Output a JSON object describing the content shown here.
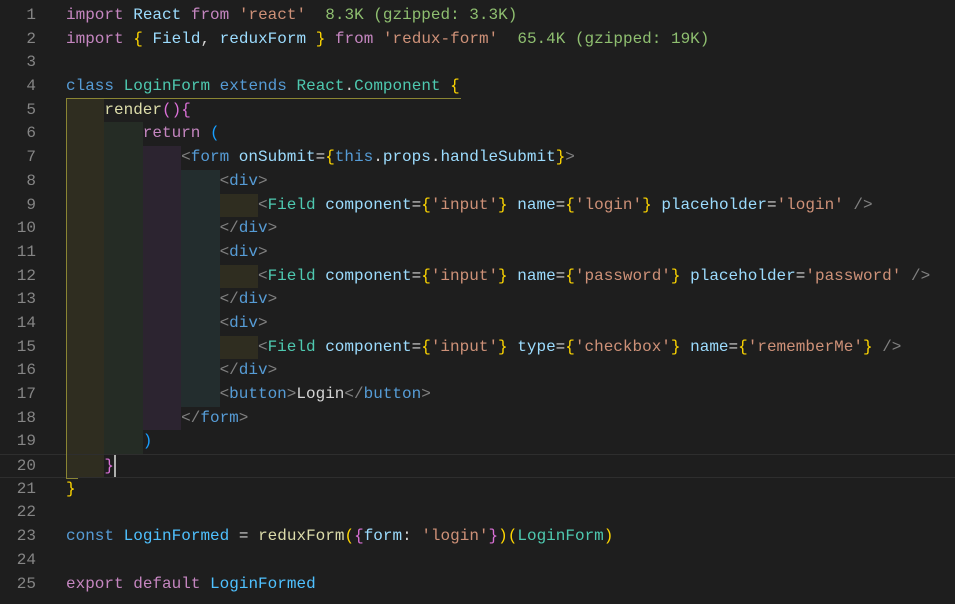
{
  "editor": {
    "lines": [
      {
        "n": "1",
        "indent": 0,
        "tokens": [
          [
            "k",
            "import"
          ],
          [
            "p",
            " "
          ],
          [
            "v",
            "React"
          ],
          [
            "p",
            " "
          ],
          [
            "k",
            "from"
          ],
          [
            "p",
            " "
          ],
          [
            "s",
            "'react'"
          ],
          [
            "p",
            "  "
          ],
          [
            "g",
            "8.3K (gzipped: 3.3K)"
          ]
        ]
      },
      {
        "n": "2",
        "indent": 0,
        "tokens": [
          [
            "k",
            "import"
          ],
          [
            "p",
            " "
          ],
          [
            "b1",
            "{"
          ],
          [
            "p",
            " "
          ],
          [
            "v",
            "Field"
          ],
          [
            "p",
            ", "
          ],
          [
            "v",
            "reduxForm"
          ],
          [
            "p",
            " "
          ],
          [
            "b1",
            "}"
          ],
          [
            "p",
            " "
          ],
          [
            "k",
            "from"
          ],
          [
            "p",
            " "
          ],
          [
            "s",
            "'redux-form'"
          ],
          [
            "p",
            "  "
          ],
          [
            "g",
            "65.4K (gzipped: 19K)"
          ]
        ]
      },
      {
        "n": "3",
        "indent": 0,
        "tokens": []
      },
      {
        "n": "4",
        "indent": 0,
        "tokens": [
          [
            "t",
            "class"
          ],
          [
            "p",
            " "
          ],
          [
            "c",
            "LoginForm"
          ],
          [
            "p",
            " "
          ],
          [
            "t",
            "extends"
          ],
          [
            "p",
            " "
          ],
          [
            "c",
            "React"
          ],
          [
            "p",
            "."
          ],
          [
            "c",
            "Component"
          ],
          [
            "p",
            " "
          ],
          [
            "b1",
            "{"
          ]
        ]
      },
      {
        "n": "5",
        "indent": 1,
        "tokens": [
          [
            "f",
            "render"
          ],
          [
            "b2",
            "()"
          ],
          [
            "b2",
            "{"
          ]
        ]
      },
      {
        "n": "6",
        "indent": 2,
        "tokens": [
          [
            "k",
            "return"
          ],
          [
            "p",
            " "
          ],
          [
            "b3",
            "("
          ]
        ]
      },
      {
        "n": "7",
        "indent": 3,
        "tokens": [
          [
            "tp",
            "<"
          ],
          [
            "t",
            "form"
          ],
          [
            "p",
            " "
          ],
          [
            "v",
            "onSubmit"
          ],
          [
            "p",
            "="
          ],
          [
            "b1",
            "{"
          ],
          [
            "t",
            "this"
          ],
          [
            "p",
            "."
          ],
          [
            "v",
            "props"
          ],
          [
            "p",
            "."
          ],
          [
            "v",
            "handleSubmit"
          ],
          [
            "b1",
            "}"
          ],
          [
            "tp",
            ">"
          ]
        ]
      },
      {
        "n": "8",
        "indent": 4,
        "tokens": [
          [
            "tp",
            "<"
          ],
          [
            "t",
            "div"
          ],
          [
            "tp",
            ">"
          ]
        ]
      },
      {
        "n": "9",
        "indent": 5,
        "tokens": [
          [
            "tp",
            "<"
          ],
          [
            "c",
            "Field"
          ],
          [
            "p",
            " "
          ],
          [
            "v",
            "component"
          ],
          [
            "p",
            "="
          ],
          [
            "b1",
            "{"
          ],
          [
            "s",
            "'input'"
          ],
          [
            "b1",
            "}"
          ],
          [
            "p",
            " "
          ],
          [
            "v",
            "name"
          ],
          [
            "p",
            "="
          ],
          [
            "b1",
            "{"
          ],
          [
            "s",
            "'login'"
          ],
          [
            "b1",
            "}"
          ],
          [
            "p",
            " "
          ],
          [
            "v",
            "placeholder"
          ],
          [
            "p",
            "="
          ],
          [
            "s",
            "'login'"
          ],
          [
            "p",
            " "
          ],
          [
            "tp",
            "/>"
          ]
        ]
      },
      {
        "n": "10",
        "indent": 4,
        "tokens": [
          [
            "tp",
            "</"
          ],
          [
            "t",
            "div"
          ],
          [
            "tp",
            ">"
          ]
        ]
      },
      {
        "n": "11",
        "indent": 4,
        "tokens": [
          [
            "tp",
            "<"
          ],
          [
            "t",
            "div"
          ],
          [
            "tp",
            ">"
          ]
        ]
      },
      {
        "n": "12",
        "indent": 5,
        "tokens": [
          [
            "tp",
            "<"
          ],
          [
            "c",
            "Field"
          ],
          [
            "p",
            " "
          ],
          [
            "v",
            "component"
          ],
          [
            "p",
            "="
          ],
          [
            "b1",
            "{"
          ],
          [
            "s",
            "'input'"
          ],
          [
            "b1",
            "}"
          ],
          [
            "p",
            " "
          ],
          [
            "v",
            "name"
          ],
          [
            "p",
            "="
          ],
          [
            "b1",
            "{"
          ],
          [
            "s",
            "'password'"
          ],
          [
            "b1",
            "}"
          ],
          [
            "p",
            " "
          ],
          [
            "v",
            "placeholder"
          ],
          [
            "p",
            "="
          ],
          [
            "s",
            "'password'"
          ],
          [
            "p",
            " "
          ],
          [
            "tp",
            "/>"
          ]
        ]
      },
      {
        "n": "13",
        "indent": 4,
        "tokens": [
          [
            "tp",
            "</"
          ],
          [
            "t",
            "div"
          ],
          [
            "tp",
            ">"
          ]
        ]
      },
      {
        "n": "14",
        "indent": 4,
        "tokens": [
          [
            "tp",
            "<"
          ],
          [
            "t",
            "div"
          ],
          [
            "tp",
            ">"
          ]
        ]
      },
      {
        "n": "15",
        "indent": 5,
        "tokens": [
          [
            "tp",
            "<"
          ],
          [
            "c",
            "Field"
          ],
          [
            "p",
            " "
          ],
          [
            "v",
            "component"
          ],
          [
            "p",
            "="
          ],
          [
            "b1",
            "{"
          ],
          [
            "s",
            "'input'"
          ],
          [
            "b1",
            "}"
          ],
          [
            "p",
            " "
          ],
          [
            "v",
            "type"
          ],
          [
            "p",
            "="
          ],
          [
            "b1",
            "{"
          ],
          [
            "s",
            "'checkbox'"
          ],
          [
            "b1",
            "}"
          ],
          [
            "p",
            " "
          ],
          [
            "v",
            "name"
          ],
          [
            "p",
            "="
          ],
          [
            "b1",
            "{"
          ],
          [
            "s",
            "'rememberMe'"
          ],
          [
            "b1",
            "}"
          ],
          [
            "p",
            " "
          ],
          [
            "tp",
            "/>"
          ]
        ]
      },
      {
        "n": "16",
        "indent": 4,
        "tokens": [
          [
            "tp",
            "</"
          ],
          [
            "t",
            "div"
          ],
          [
            "tp",
            ">"
          ]
        ]
      },
      {
        "n": "17",
        "indent": 4,
        "tokens": [
          [
            "tp",
            "<"
          ],
          [
            "t",
            "button"
          ],
          [
            "tp",
            ">"
          ],
          [
            "p",
            "Login"
          ],
          [
            "tp",
            "</"
          ],
          [
            "t",
            "button"
          ],
          [
            "tp",
            ">"
          ]
        ]
      },
      {
        "n": "18",
        "indent": 3,
        "tokens": [
          [
            "tp",
            "</"
          ],
          [
            "t",
            "form"
          ],
          [
            "tp",
            ">"
          ]
        ]
      },
      {
        "n": "19",
        "indent": 2,
        "tokens": [
          [
            "b3",
            ")"
          ]
        ]
      },
      {
        "n": "20",
        "indent": 1,
        "tokens": [
          [
            "b2",
            "}"
          ]
        ],
        "current": true
      },
      {
        "n": "21",
        "indent": 0,
        "tokens": [
          [
            "b1",
            "}"
          ]
        ]
      },
      {
        "n": "22",
        "indent": 0,
        "tokens": []
      },
      {
        "n": "23",
        "indent": 0,
        "tokens": [
          [
            "t",
            "const"
          ],
          [
            "p",
            " "
          ],
          [
            "vc",
            "LoginFormed"
          ],
          [
            "p",
            " = "
          ],
          [
            "f",
            "reduxForm"
          ],
          [
            "b1",
            "("
          ],
          [
            "b2",
            "{"
          ],
          [
            "v",
            "form"
          ],
          [
            "p",
            ": "
          ],
          [
            "s",
            "'login'"
          ],
          [
            "b2",
            "}"
          ],
          [
            "b1",
            ")"
          ],
          [
            "b1",
            "("
          ],
          [
            "c",
            "LoginForm"
          ],
          [
            "b1",
            ")"
          ]
        ]
      },
      {
        "n": "24",
        "indent": 0,
        "tokens": []
      },
      {
        "n": "25",
        "indent": 0,
        "tokens": [
          [
            "k",
            "export"
          ],
          [
            "p",
            " "
          ],
          [
            "k",
            "default"
          ],
          [
            "p",
            " "
          ],
          [
            "vc",
            "LoginFormed"
          ]
        ]
      }
    ]
  }
}
